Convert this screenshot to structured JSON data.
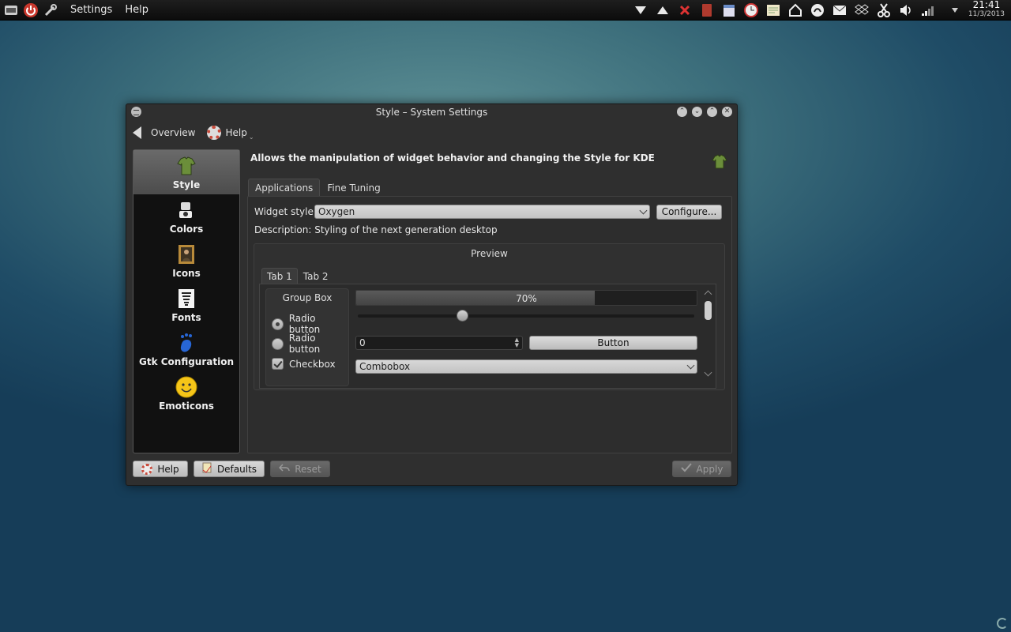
{
  "topbar": {
    "menus": [
      "Settings",
      "Help"
    ],
    "clock": {
      "time": "21:41",
      "date": "11/3/2013"
    },
    "tray_icons": [
      "down-triangle-icon",
      "up-triangle-icon",
      "red-x-icon",
      "book-icon",
      "calendar-icon",
      "clock-icon",
      "notes-icon",
      "home-icon",
      "headset-icon",
      "mail-icon",
      "dropbox-icon",
      "scissors-icon",
      "volume-icon",
      "signal-icon",
      "chevron-down-icon"
    ]
  },
  "window": {
    "title": "Style – System Settings",
    "toolbar": {
      "overview": "Overview",
      "help": "Help"
    },
    "sidebar": {
      "items": [
        {
          "label": "Style",
          "icon": "shirt-icon",
          "active": true
        },
        {
          "label": "Colors",
          "icon": "paint-icon",
          "active": false
        },
        {
          "label": "Icons",
          "icon": "portrait-icon",
          "active": false
        },
        {
          "label": "Fonts",
          "icon": "eye-chart-icon",
          "active": false
        },
        {
          "label": "Gtk Configuration",
          "icon": "gnome-foot-icon",
          "active": false
        },
        {
          "label": "Emoticons",
          "icon": "smiley-icon",
          "active": false
        }
      ]
    },
    "module_description": "Allows the manipulation of widget behavior and changing the Style for KDE",
    "tabs": [
      "Applications",
      "Fine Tuning"
    ],
    "widget_style": {
      "label": "Widget style:",
      "value": "Oxygen",
      "configure": "Configure..."
    },
    "description": "Description: Styling of the next generation desktop",
    "preview": {
      "title": "Preview",
      "tabs": [
        "Tab 1",
        "Tab 2"
      ],
      "group_box": "Group Box",
      "radio1": "Radio button",
      "radio2": "Radio button",
      "checkbox": "Checkbox",
      "progress_text": "70%",
      "progress_value": 0.7,
      "slider_value": 0.31,
      "spin_value": "0",
      "button": "Button",
      "combobox": "Combobox"
    },
    "buttons": {
      "help": "Help",
      "defaults": "Defaults",
      "reset": "Reset",
      "apply": "Apply"
    }
  },
  "colors": {
    "accent_red": "#c94b3c",
    "sidebar_active": "#5b5b5b"
  }
}
